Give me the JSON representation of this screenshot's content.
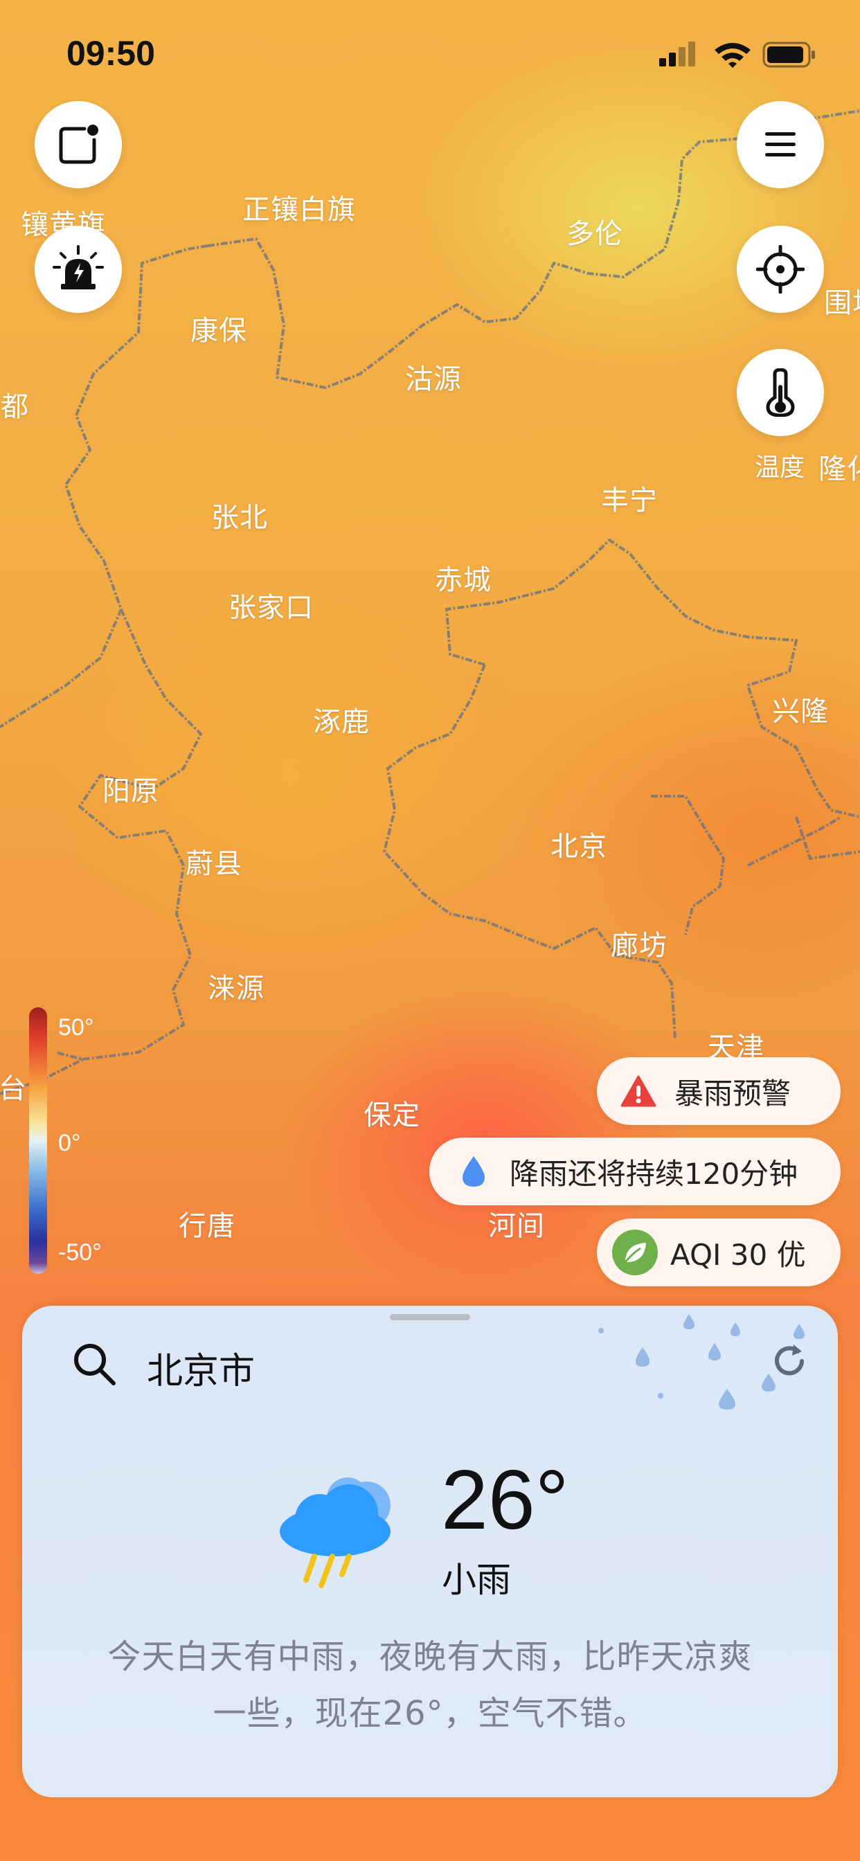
{
  "status_bar": {
    "time": "09:50"
  },
  "map": {
    "places": [
      {
        "id": "xianghuangqi",
        "name": "镶黄旗"
      },
      {
        "id": "zhengxiangbaiqi",
        "name": "正镶白旗"
      },
      {
        "id": "duolun",
        "name": "多伦"
      },
      {
        "id": "kangbao",
        "name": "康保"
      },
      {
        "id": "guyuan",
        "name": "沽源"
      },
      {
        "id": "weichang",
        "name": "围场"
      },
      {
        "id": "shangdu",
        "name": "商都"
      },
      {
        "id": "zhangbei",
        "name": "张北"
      },
      {
        "id": "fengning",
        "name": "丰宁"
      },
      {
        "id": "longhua",
        "name": "隆化"
      },
      {
        "id": "chicheng",
        "name": "赤城"
      },
      {
        "id": "zhangjiakou",
        "name": "张家口"
      },
      {
        "id": "zhuolu",
        "name": "涿鹿"
      },
      {
        "id": "xinglong",
        "name": "兴隆"
      },
      {
        "id": "yangyuan",
        "name": "阳原"
      },
      {
        "id": "yuxian",
        "name": "蔚县"
      },
      {
        "id": "beijing",
        "name": "北京"
      },
      {
        "id": "langfang",
        "name": "廊坊"
      },
      {
        "id": "laiyuan",
        "name": "涞源"
      },
      {
        "id": "tianjin",
        "name": "天津"
      },
      {
        "id": "wutai",
        "name": "台"
      },
      {
        "id": "baoding",
        "name": "保定"
      },
      {
        "id": "xingtang",
        "name": "行唐"
      },
      {
        "id": "hejian",
        "name": "河间"
      }
    ]
  },
  "layer": {
    "label": "温度"
  },
  "legend": {
    "max": "50°",
    "mid": "0°",
    "min": "-50°"
  },
  "alerts": {
    "rainstorm": "暴雨预警",
    "rain_duration": "降雨还将持续120分钟",
    "aqi": "AQI 30 优"
  },
  "weather": {
    "city": "北京市",
    "temperature": "26°",
    "condition": "小雨",
    "summary_line1": "今天白天有中雨，夜晚有大雨，比昨天凉爽",
    "summary_line2": "一些，现在26°，空气不错。"
  },
  "colors": {
    "accent_blue": "#2d9cff",
    "alert_red": "#e8403a",
    "aqi_green": "#6fb04a",
    "rain_yellow": "#f2c41a"
  },
  "icons": {
    "share": "share-icon",
    "warning_light": "alarm-light-icon",
    "menu": "menu-icon",
    "locate": "crosshair-icon",
    "temperature": "thermometer-icon",
    "search": "search-icon",
    "refresh": "refresh-icon",
    "weather": "rain-cloud-icon"
  }
}
